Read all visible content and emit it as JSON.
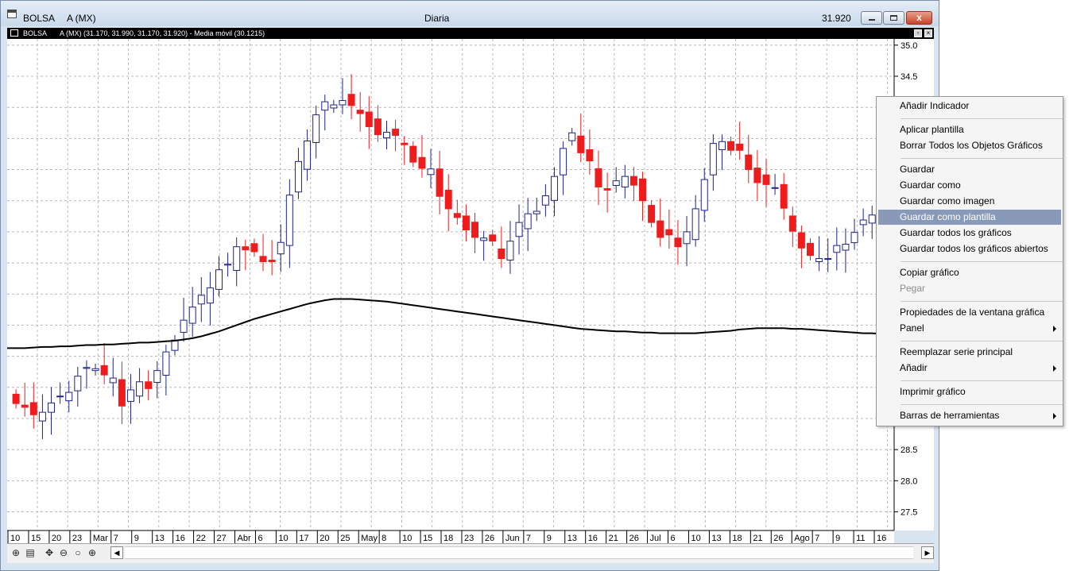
{
  "window": {
    "app_name": "BOLSA",
    "symbol": "A (MX)",
    "period": "Diaria",
    "last_price": "31.920",
    "close_glyph": "x"
  },
  "subheader": {
    "app_name": "BOLSA",
    "info": "A (MX) (31.170, 31.990, 31.170, 31.920) - Media móvil (30.1215)"
  },
  "colors": {
    "up": "#1f2488",
    "down": "#ee1c1c",
    "ma": "#000000",
    "grid": "#b8b8b8",
    "menu_highlight": "#8999b8"
  },
  "chart_data": {
    "type": "candlestick",
    "y_ticks": [
      "35.0",
      "34.5",
      "28.5",
      "28.0",
      "27.5"
    ],
    "ylim": [
      27.2,
      35.1
    ],
    "x_tick_labels": [
      "10",
      "15",
      "20",
      "23",
      "Mar",
      "7",
      "9",
      "13",
      "16",
      "22",
      "27",
      "Abr",
      "6",
      "10",
      "17",
      "20",
      "25",
      "May",
      "8",
      "10",
      "15",
      "18",
      "23",
      "26",
      "Jun",
      "7",
      "9",
      "13",
      "16",
      "21",
      "26",
      "Jul",
      "6",
      "10",
      "13",
      "18",
      "21",
      "26",
      "Ago",
      "7",
      "9",
      "11",
      "16"
    ],
    "grid": true,
    "series": [
      {
        "name": "A (MX)",
        "close": [
          29.24,
          29.18,
          29.06,
          29.1,
          29.25,
          29.36,
          29.42,
          29.68,
          29.82,
          29.8,
          29.7,
          29.65,
          29.2,
          29.46,
          29.59,
          29.48,
          29.77,
          30.07,
          30.26,
          30.58,
          30.79,
          30.98,
          31.1,
          31.39,
          31.48,
          31.76,
          31.71,
          31.68,
          31.52,
          31.52,
          31.83,
          32.59,
          33.13,
          33.46,
          33.88,
          34.09,
          34.04,
          34.11,
          34.03,
          33.9,
          33.69,
          33.56,
          33.6,
          33.55,
          33.4,
          33.12,
          33.02,
          33.01,
          32.57,
          32.37,
          32.23,
          32.03,
          31.91,
          31.9,
          31.85,
          31.57,
          31.85,
          32.15,
          32.29,
          32.33,
          32.58,
          32.89,
          33.34,
          33.59,
          33.27,
          33.14,
          32.72,
          32.67,
          32.82,
          32.89,
          32.75,
          32.5,
          32.15,
          31.91,
          31.95,
          31.76,
          32.0,
          32.37,
          32.84,
          33.42,
          33.45,
          33.31,
          33.31,
          33.0,
          32.79,
          32.76,
          32.71,
          32.38,
          32.01,
          31.74,
          31.62,
          31.57,
          31.57,
          31.78,
          31.8,
          31.99,
          32.19,
          32.27,
          31.92
        ],
        "ma": [
          30.13,
          30.13,
          30.14,
          30.15,
          30.15,
          30.16,
          30.16,
          30.17,
          30.18,
          30.18,
          30.19,
          30.19,
          30.2,
          30.21,
          30.22,
          30.22,
          30.23,
          30.24,
          30.25,
          30.27,
          30.29,
          30.32,
          30.36,
          30.4,
          30.45,
          30.5,
          30.55,
          30.6,
          30.64,
          30.68,
          30.72,
          30.76,
          30.8,
          30.84,
          30.87,
          30.9,
          30.92,
          30.92,
          30.92,
          30.91,
          30.9,
          30.89,
          30.88,
          30.86,
          30.84,
          30.82,
          30.8,
          30.78,
          30.76,
          30.74,
          30.72,
          30.7,
          30.68,
          30.66,
          30.64,
          30.62,
          30.6,
          30.58,
          30.56,
          30.54,
          30.52,
          30.5,
          30.48,
          30.46,
          30.44,
          30.43,
          30.42,
          30.41,
          30.4,
          30.4,
          30.39,
          30.38,
          30.38,
          30.37,
          30.37,
          30.37,
          30.37,
          30.37,
          30.38,
          30.39,
          30.4,
          30.41,
          30.43,
          30.44,
          30.45,
          30.45,
          30.45,
          30.45,
          30.44,
          30.44,
          30.43,
          30.42,
          30.41,
          30.4,
          30.39,
          30.38,
          30.37,
          30.37,
          30.36
        ]
      }
    ]
  },
  "toolbar_icons": [
    "crosshair-icon",
    "data-window-icon",
    "move-icon",
    "zoom-out-icon",
    "zoom-icon",
    "zoom-in-icon"
  ],
  "scroll": {
    "left_arrow": "◀",
    "right_arrow": "▶"
  },
  "context_menu": {
    "items": [
      {
        "label": "Añadir Indicador",
        "submenu": false,
        "disabled": false,
        "highlighted": false
      },
      {
        "label": "Aplicar plantilla",
        "submenu": false,
        "disabled": false,
        "highlighted": false
      },
      {
        "label": "Borrar Todos los Objetos Gráficos",
        "submenu": false,
        "disabled": false,
        "highlighted": false
      },
      {
        "label": "Guardar",
        "submenu": false,
        "disabled": false,
        "highlighted": false
      },
      {
        "label": "Guardar como",
        "submenu": false,
        "disabled": false,
        "highlighted": false
      },
      {
        "label": "Guardar como imagen",
        "submenu": false,
        "disabled": false,
        "highlighted": false
      },
      {
        "label": "Guardar como plantilla",
        "submenu": false,
        "disabled": false,
        "highlighted": true
      },
      {
        "label": "Guardar todos los gráficos",
        "submenu": false,
        "disabled": false,
        "highlighted": false
      },
      {
        "label": "Guardar todos los gráficos abiertos",
        "submenu": false,
        "disabled": false,
        "highlighted": false
      },
      {
        "label": "Copiar gráfico",
        "submenu": false,
        "disabled": false,
        "highlighted": false
      },
      {
        "label": "Pegar",
        "submenu": false,
        "disabled": true,
        "highlighted": false
      },
      {
        "label": "Propiedades de la ventana gráfica",
        "submenu": false,
        "disabled": false,
        "highlighted": false
      },
      {
        "label": "Panel",
        "submenu": true,
        "disabled": false,
        "highlighted": false
      },
      {
        "label": "Reemplazar serie principal",
        "submenu": false,
        "disabled": false,
        "highlighted": false
      },
      {
        "label": "Añadir",
        "submenu": true,
        "disabled": false,
        "highlighted": false
      },
      {
        "label": "Imprimir gráfico",
        "submenu": false,
        "disabled": false,
        "highlighted": false
      },
      {
        "label": "Barras de herramientas",
        "submenu": true,
        "disabled": false,
        "highlighted": false
      }
    ]
  }
}
